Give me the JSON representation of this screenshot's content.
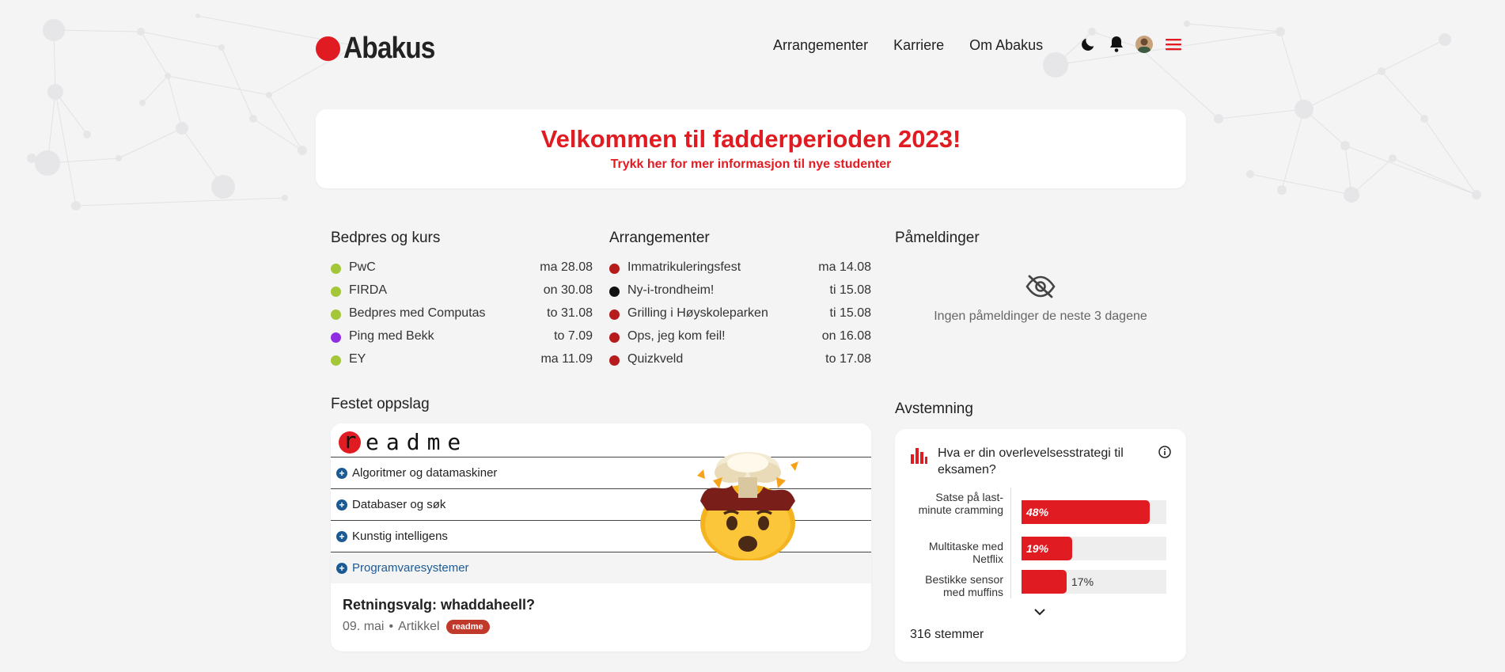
{
  "header": {
    "logo_text": "Abakus",
    "nav": [
      "Arrangementer",
      "Karriere",
      "Om Abakus"
    ],
    "icons": [
      "moon-icon",
      "bell-icon",
      "avatar",
      "menu-icon"
    ]
  },
  "banner": {
    "title": "Velkommen til fadderperioden 2023!",
    "subtitle": "Trykk her for mer informasjon til nye studenter"
  },
  "bedpres": {
    "title": "Bedpres og kurs",
    "items": [
      {
        "title": "PwC",
        "date": "ma 28.08",
        "color": "#a4c639"
      },
      {
        "title": "FIRDA",
        "date": "on 30.08",
        "color": "#a4c639"
      },
      {
        "title": "Bedpres med Computas",
        "date": "to 31.08",
        "color": "#a4c639"
      },
      {
        "title": "Ping med Bekk",
        "date": "to 7.09",
        "color": "#8e2de2"
      },
      {
        "title": "EY",
        "date": "ma 11.09",
        "color": "#a4c639"
      }
    ]
  },
  "events": {
    "title": "Arrangementer",
    "items": [
      {
        "title": "Immatrikuleringsfest",
        "date": "ma 14.08",
        "color": "#b71c1c"
      },
      {
        "title": "Ny-i-trondheim!",
        "date": "ti 15.08",
        "color": "#111111"
      },
      {
        "title": "Grilling i Høyskoleparken",
        "date": "ti 15.08",
        "color": "#b71c1c"
      },
      {
        "title": "Ops, jeg kom feil!",
        "date": "on 16.08",
        "color": "#b71c1c"
      },
      {
        "title": "Quizkveld",
        "date": "to 17.08",
        "color": "#b71c1c"
      }
    ]
  },
  "registrations": {
    "title": "Påmeldinger",
    "empty_text": "Ingen påmeldinger de neste 3 dagene"
  },
  "pinned": {
    "section_title": "Festet oppslag",
    "image": {
      "logo_letter": "r",
      "logo_text": "eadme",
      "courses": [
        "Algoritmer og datamaskiner",
        "Databaser og søk",
        "Kunstig intelligens",
        "Programvaresystemer"
      ]
    },
    "title": "Retningsvalg: whaddaheell?",
    "date": "09. mai",
    "separator": "•",
    "type": "Artikkel",
    "tag": "readme"
  },
  "poll": {
    "section_title": "Avstemning",
    "question": "Hva er din overlevelsesstrategi til eksamen?",
    "options": [
      {
        "label": "Satse på last-minute cramming",
        "percent": 48,
        "percent_text": "48%"
      },
      {
        "label": "Multitaske med Netflix",
        "percent": 19,
        "percent_text": "19%"
      },
      {
        "label": "Bestikke sensor med muffins",
        "percent": 17,
        "percent_text": "17%"
      }
    ],
    "votes": "316",
    "votes_label": "stemmer"
  },
  "colors": {
    "brand_red": "#e11b22",
    "link_blue": "#1c5a96"
  }
}
